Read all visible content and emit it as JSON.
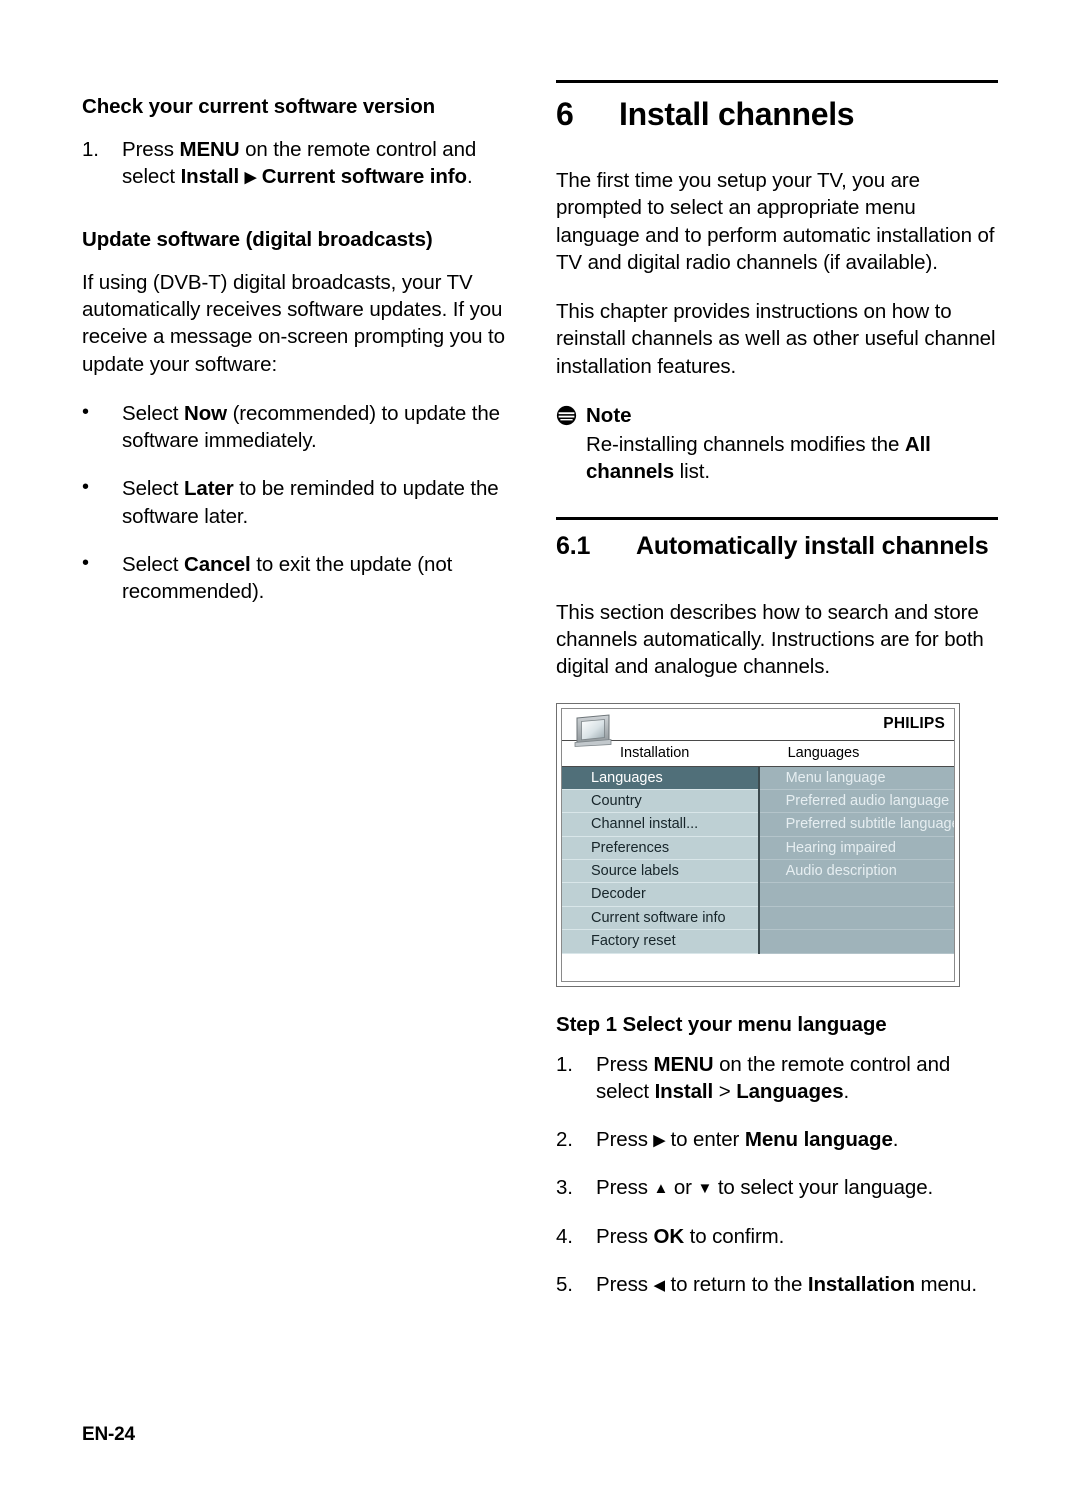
{
  "page": {
    "footer_label": "EN-24"
  },
  "left_column": {
    "heading_check": "Check your current software version",
    "step_check": {
      "marker": "1.",
      "line1_pre": "Press ",
      "line1_bold": "MENU",
      "line1_post": " on the remote control and",
      "line2_pre": "select ",
      "line2_bold1": "Install",
      "line2_arrow": "▶",
      "line2_bold2": "Current software info",
      "line2_post": "."
    },
    "heading_update": "Update software (digital broadcasts)",
    "paragraph_update": "If using (DVB-T) digital broadcasts, your TV automatically receives software updates. If you receive a message on-screen prompting you to update your software:",
    "bullets": [
      {
        "marker": "•",
        "pre": "Select ",
        "bold": "Now",
        "post": " (recommended) to update the software immediately."
      },
      {
        "marker": "•",
        "pre": "Select ",
        "bold": "Later",
        "post": " to be reminded to update the software later."
      },
      {
        "marker": "•",
        "pre": "Select ",
        "bold": "Cancel",
        "post": " to exit the update (not recommended)."
      }
    ]
  },
  "right_column": {
    "chapter": {
      "number": "6",
      "title": "Install channels"
    },
    "intro_paragraph_1": "The first time you setup your TV, you are prompted to select an appropriate menu language and to perform automatic installation of TV and digital radio channels (if available).",
    "intro_paragraph_2": "This chapter provides instructions on how to reinstall channels as well as other useful channel installation features.",
    "note": {
      "icon": "note-icon",
      "title": "Note",
      "body_pre": "Re-installing channels modifies the ",
      "body_bold": "All channels",
      "body_post": " list."
    },
    "section": {
      "number": "6.1",
      "title": "Automatically install channels"
    },
    "section_paragraph": "This section describes how to search and store channels automatically. Instructions are for both digital and analogue channels.",
    "tv_menu": {
      "brand": "PHILIPS",
      "tv_icon": "tv-set-icon",
      "tab_left": "Installation",
      "tab_right": "Languages",
      "left_items": [
        {
          "label": "Languages",
          "selected": true
        },
        {
          "label": "Country",
          "selected": false
        },
        {
          "label": "Channel install...",
          "selected": false
        },
        {
          "label": "Preferences",
          "selected": false
        },
        {
          "label": "Source labels",
          "selected": false
        },
        {
          "label": "Decoder",
          "selected": false
        },
        {
          "label": "Current software info",
          "selected": false
        },
        {
          "label": "Factory reset",
          "selected": false
        }
      ],
      "right_items": [
        {
          "label": "Menu language"
        },
        {
          "label": "Preferred audio language"
        },
        {
          "label": "Preferred subtitle language"
        },
        {
          "label": "Hearing impaired"
        },
        {
          "label": "Audio description"
        },
        {
          "label": ""
        },
        {
          "label": ""
        },
        {
          "label": ""
        }
      ]
    },
    "step_heading": "Step 1 Select your menu language",
    "steps": [
      {
        "marker": "1.",
        "p1": "Press ",
        "b1": "MENU",
        "p2": " on the remote control and select ",
        "b2": "Install",
        "p3": " > ",
        "b3": "Languages",
        "p4": "."
      },
      {
        "marker": "2.",
        "p1": "Press ",
        "b1": "▶",
        "p2": " to enter ",
        "b2": "Menu language",
        "p3": "",
        "b3": "",
        "p4": "."
      },
      {
        "marker": "3.",
        "p1": "Press ",
        "b1": "▲",
        "p2": " or ",
        "b2": "▼",
        "p3": " to select your language.",
        "b3": "",
        "p4": ""
      },
      {
        "marker": "4.",
        "p1": "Press ",
        "b1": "OK",
        "p2": " to confirm.",
        "b2": "",
        "p3": "",
        "b3": "",
        "p4": ""
      },
      {
        "marker": "5.",
        "p1": "Press ",
        "b1": "◀",
        "p2": " to return to the ",
        "b2": "Installation",
        "p3": " menu.",
        "b3": "",
        "p4": ""
      }
    ]
  },
  "colors": {
    "menu_selected": "#506f79",
    "menu_item": "#bed0d4",
    "menu_right_panel": "#9fb3ba",
    "rule": "#000000"
  }
}
